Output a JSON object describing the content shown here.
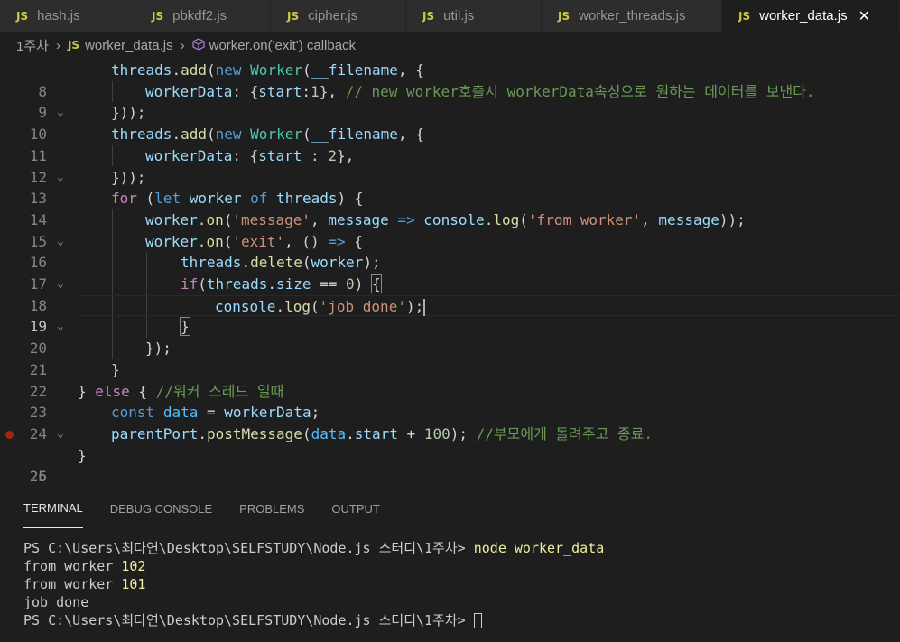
{
  "tabs": [
    {
      "icon": "JS",
      "label": "hash.js"
    },
    {
      "icon": "JS",
      "label": "pbkdf2.js"
    },
    {
      "icon": "JS",
      "label": "cipher.js"
    },
    {
      "icon": "JS",
      "label": "util.js"
    },
    {
      "icon": "JS",
      "label": "worker_threads.js"
    },
    {
      "icon": "JS",
      "label": "worker_data.js",
      "close": "✕"
    }
  ],
  "breadcrumb": {
    "folder": "1주차",
    "sep": "›",
    "file_icon": "JS",
    "file": "worker_data.js",
    "symbol_icon": "cube-icon",
    "symbol": "worker.on('exit') callback"
  },
  "editor": {
    "lines": [
      {
        "n": "8"
      },
      {
        "n": "9"
      },
      {
        "n": "10"
      },
      {
        "n": "11"
      },
      {
        "n": "12"
      },
      {
        "n": "13"
      },
      {
        "n": "14"
      },
      {
        "n": "15"
      },
      {
        "n": "16"
      },
      {
        "n": "17"
      },
      {
        "n": "18"
      },
      {
        "n": "19"
      },
      {
        "n": "20"
      },
      {
        "n": "21"
      },
      {
        "n": "22"
      },
      {
        "n": "23"
      },
      {
        "n": "24"
      },
      {
        "n": "25"
      },
      {
        "n": "26"
      }
    ],
    "tokens": {
      "threads": "threads",
      "add": "add",
      "new": "new",
      "Worker": "Worker",
      "filename": "__filename",
      "workerData": "workerData",
      "start": "start",
      "one": "1",
      "two": "2",
      "comment9": "// new worker호출시 workerData속성으로 원하는 데이터를 보낸다.",
      "for": "for",
      "let": "let",
      "worker": "worker",
      "of": "of",
      "on": "on",
      "message_str": "'message'",
      "message": "message",
      "console": "console",
      "log": "log",
      "from_worker_str": "'from worker'",
      "exit_str": "'exit'",
      "delete": "delete",
      "if": "if",
      "size": "size",
      "zero": "0",
      "job_done_str": "'job done'",
      "else": "else",
      "comment23": "//워커 스레드 일때",
      "const": "const",
      "data": "data",
      "parentPort": "parentPort",
      "postMessage": "postMessage",
      "hundred": "100",
      "comment25": "//부모에게 돌려주고 종료."
    }
  },
  "panel": {
    "tabs": [
      "TERMINAL",
      "DEBUG CONSOLE",
      "PROBLEMS",
      "OUTPUT"
    ],
    "terminal": {
      "prompt1": "PS C:\\Users\\최다연\\Desktop\\SELFSTUDY\\Node.js 스터디\\1주차> ",
      "command": "node worker_data",
      "out1_text": "from worker ",
      "out1_num": "102",
      "out2_text": "from worker ",
      "out2_num": "101",
      "out3": "job done",
      "prompt2": "PS C:\\Users\\최다연\\Desktop\\SELFSTUDY\\Node.js 스터디\\1주차> "
    }
  },
  "colors": {
    "background": "#1e1e1e",
    "keyword": "#569cd6",
    "control": "#c586c0",
    "variable": "#9cdcfe",
    "function": "#dcdcaa",
    "class": "#4ec9b0",
    "string": "#ce9178",
    "number": "#b5cea8",
    "comment": "#6a9955",
    "js_icon": "#cbcb41",
    "breakpoint": "#a1260d"
  }
}
